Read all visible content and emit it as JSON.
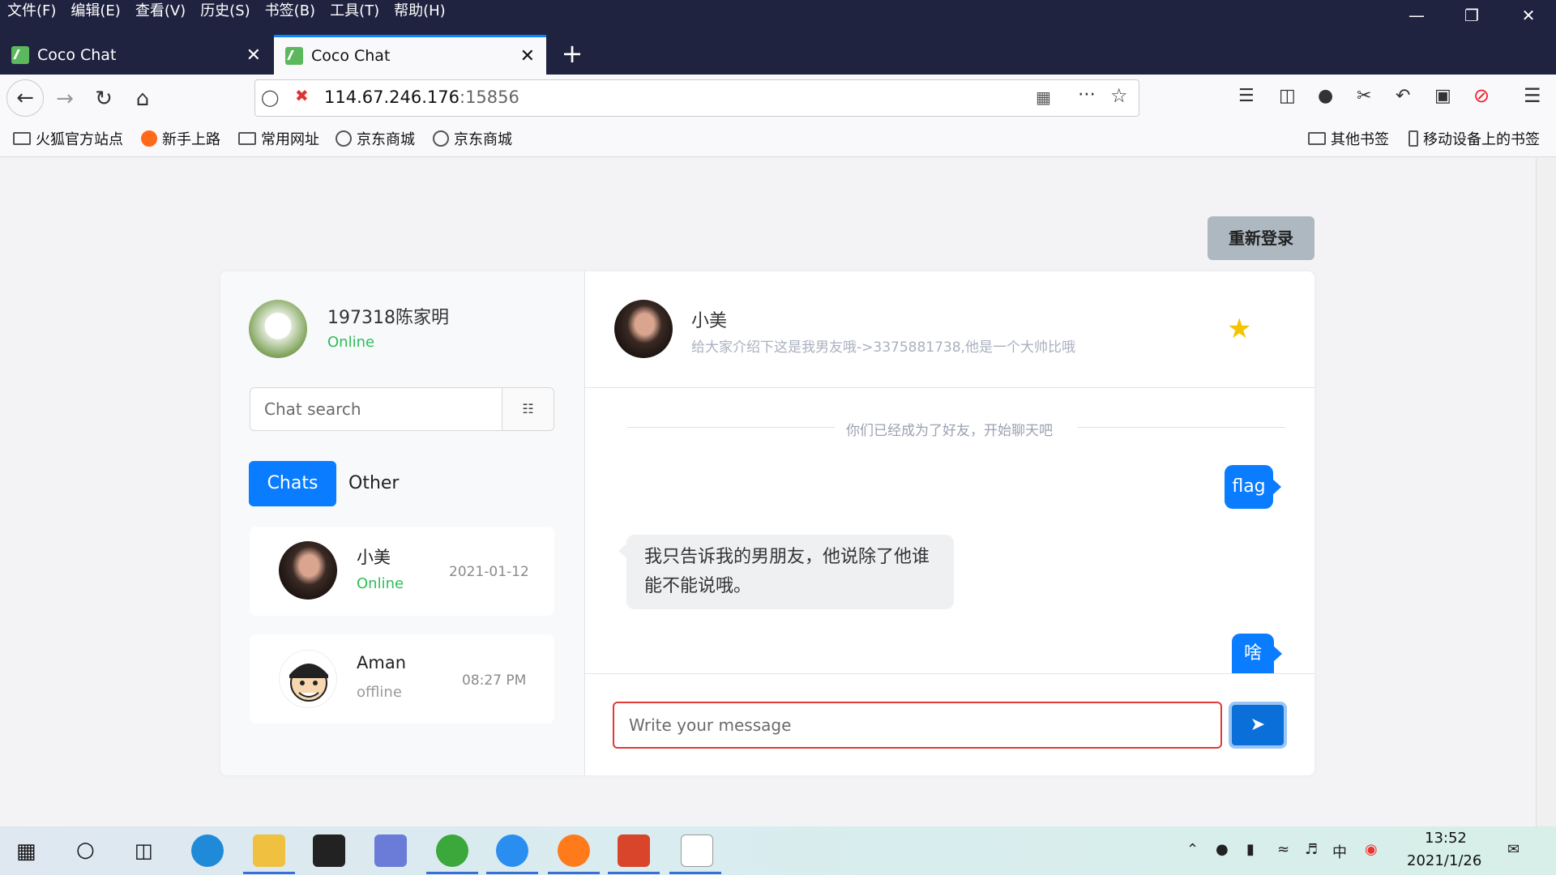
{
  "browser": {
    "menu": [
      "文件(F)",
      "编辑(E)",
      "查看(V)",
      "历史(S)",
      "书签(B)",
      "工具(T)",
      "帮助(H)"
    ],
    "tabs": [
      {
        "title": "Coco Chat"
      },
      {
        "title": "Coco Chat"
      }
    ],
    "url_host": "114.67.246.176",
    "url_port": ":15856",
    "bookmarks": [
      "火狐官方站点",
      "新手上路",
      "常用网址",
      "京东商城",
      "京东商城"
    ],
    "bookmarks_right": [
      "其他书签",
      "移动设备上的书签"
    ]
  },
  "page": {
    "relogin_label": "重新登录",
    "me": {
      "name": "197318陈家明",
      "status": "Online"
    },
    "search": {
      "placeholder": "Chat search"
    },
    "tabs": {
      "chats": "Chats",
      "other": "Other"
    },
    "contacts": [
      {
        "name": "小美",
        "status": "Online",
        "time": "2021-01-12"
      },
      {
        "name": "Aman",
        "status": "offline",
        "time": "08:27 PM"
      }
    ],
    "peer": {
      "name": "小美",
      "signature": "给大家介绍下这是我男友哦->3375881738,他是一个大帅比哦"
    },
    "divider": "你们已经成为了好友，开始聊天吧",
    "messages": [
      {
        "from": "me",
        "text": "flag"
      },
      {
        "from": "peer",
        "text": "我只告诉我的男朋友，他说除了他谁能不能说哦。"
      },
      {
        "from": "me",
        "text": "啥"
      }
    ],
    "composer": {
      "placeholder": "Write your message"
    }
  },
  "taskbar": {
    "time": "13:52",
    "date": "2021/1/26"
  },
  "colors": {
    "accent": "#0a7cff",
    "online": "#2ebd59",
    "titlebar": "#202340"
  }
}
